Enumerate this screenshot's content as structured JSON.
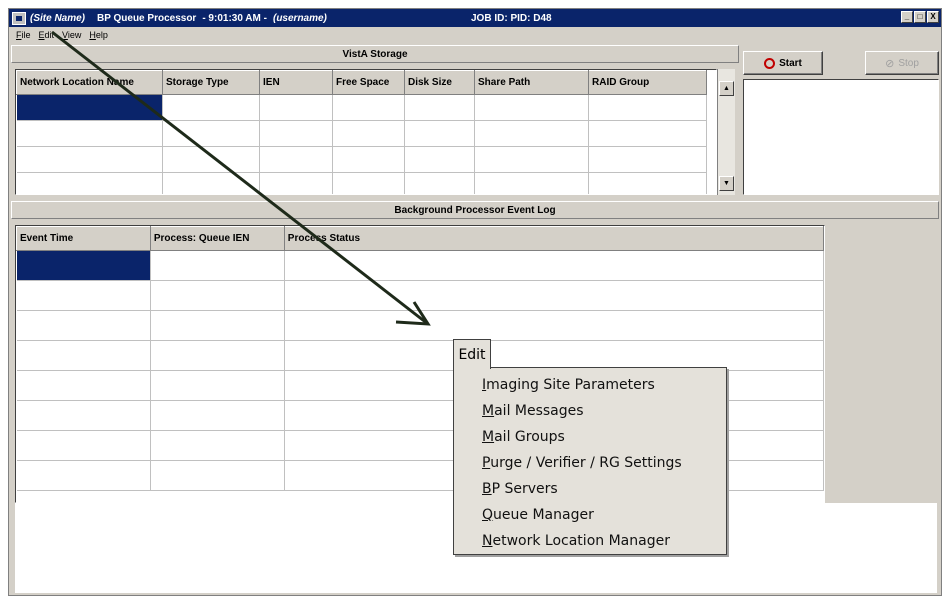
{
  "window": {
    "site_name": "(Site Name)",
    "app_title": "BP Queue Processor",
    "time": "- 9:01:30 AM -",
    "username": "(username)",
    "job_id": "JOB ID: PID: D48",
    "buttons": [
      "_",
      "□",
      "X"
    ]
  },
  "menubar": [
    "File",
    "Edit",
    "View",
    "Help"
  ],
  "storage": {
    "title": "VistA Storage",
    "columns": [
      "Network Location Name",
      "Storage Type",
      "IEN",
      "Free Space",
      "Disk Size",
      "Share Path",
      "RAID Group"
    ]
  },
  "controls": {
    "start_label": "Start",
    "stop_label": "Stop"
  },
  "event_log": {
    "title": "Background Processor Event Log",
    "columns": [
      "Event Time",
      "Process: Queue IEN",
      "Process Status"
    ]
  },
  "edit_menu": {
    "tab_label": "Edit",
    "items": [
      "Imaging Site Parameters",
      "Mail Messages",
      "Mail Groups",
      "Purge / Verifier / RG Settings",
      "BP Servers",
      "Queue Manager",
      "Network Location Manager"
    ]
  },
  "colors": {
    "titlebar": "#0a246a",
    "face": "#d4d0c8",
    "selection": "#0a246a",
    "start_icon": "#c00000",
    "arrow": "#1e2a1a"
  },
  "icons": [
    "app-icon",
    "start-circle-icon",
    "stop-icon",
    "scroll-up-icon",
    "scroll-down-icon",
    "arrow-pointer-icon"
  ]
}
